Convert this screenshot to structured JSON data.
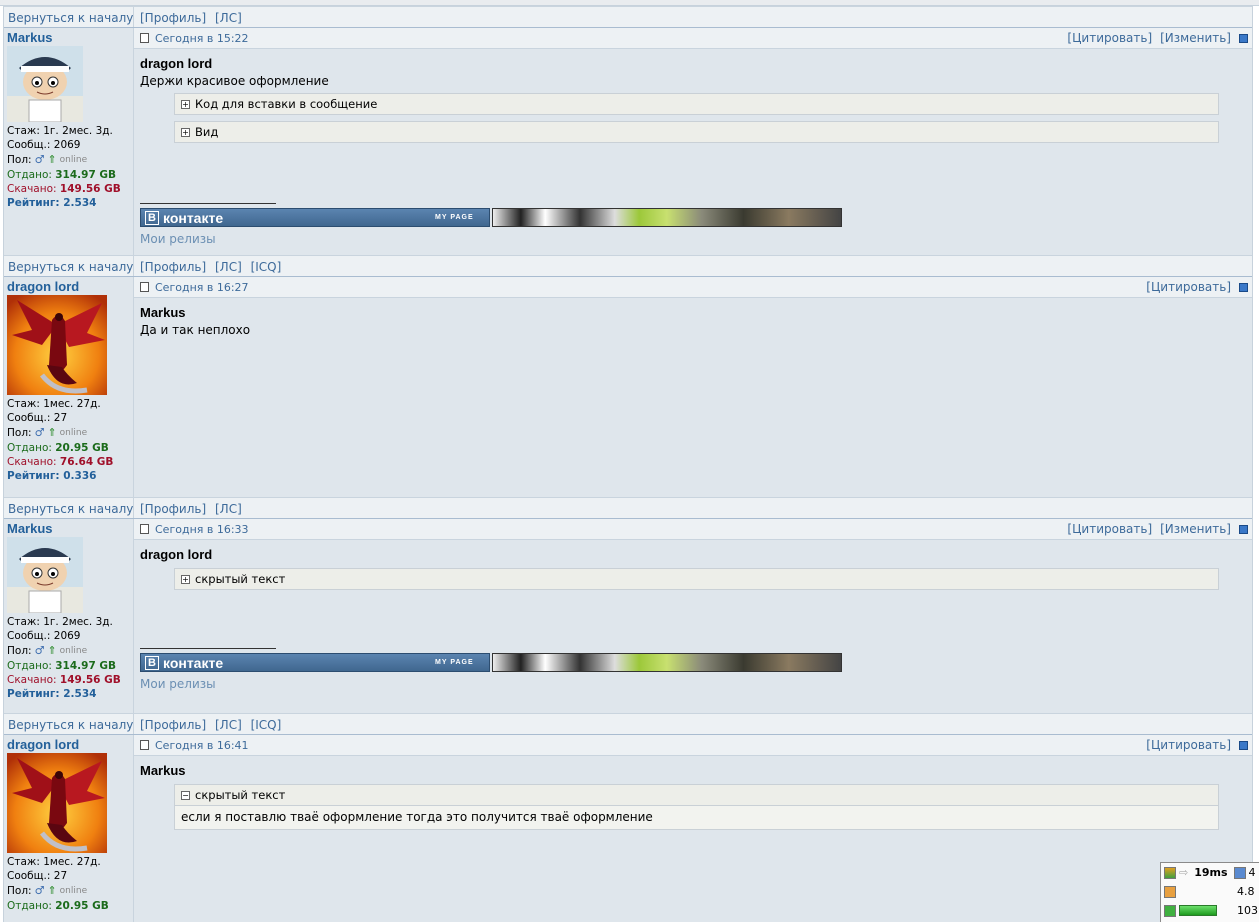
{
  "footer_links": {
    "back": "Вернуться к началу",
    "profile": "[Профиль]",
    "pm": "[ЛС]",
    "icq": "[ICQ]"
  },
  "posts": [
    {
      "author": "Markus",
      "avatar": "stewie-avatar",
      "stazh": "Стаж: 1г. 2мес. 3д.",
      "soob": "Сообщ.: 2069",
      "pol": "Пол:",
      "online": "online",
      "otdano_label": "Отдано:",
      "otdano": "314.97 GB",
      "skachano_label": "Скачано:",
      "skachano": "149.56 GB",
      "rating_label": "Рейтинг:",
      "rating": "2.534",
      "time": "Сегодня в 15:22",
      "actions": [
        "[Цитировать]",
        "[Изменить]"
      ],
      "to": "dragon lord",
      "text": "Держи красивое оформление",
      "spoilers": [
        {
          "title": "Код для вставки в сообщение",
          "sign": "+"
        },
        {
          "title": "Вид",
          "sign": "+"
        }
      ],
      "signature": {
        "vk_brand": "контакте",
        "vk_page": "MY PAGE",
        "releases": "Мои релизы"
      },
      "footer_icq": false
    },
    {
      "author": "dragon lord",
      "avatar": "red-dragon-avatar",
      "stazh": "Стаж: 1мес. 27д.",
      "soob": "Сообщ.: 27",
      "pol": "Пол:",
      "online": "online",
      "otdano_label": "Отдано:",
      "otdano": "20.95 GB",
      "skachano_label": "Скачано:",
      "skachano": "76.64 GB",
      "rating_label": "Рейтинг:",
      "rating": "0.336",
      "time": "Сегодня в 16:27",
      "actions": [
        "[Цитировать]"
      ],
      "to": "Markus",
      "text": "Да и так неплохо",
      "footer_icq": true
    },
    {
      "author": "Markus",
      "avatar": "stewie-avatar",
      "stazh": "Стаж: 1г. 2мес. 3д.",
      "soob": "Сообщ.: 2069",
      "pol": "Пол:",
      "online": "online",
      "otdano_label": "Отдано:",
      "otdano": "314.97 GB",
      "skachano_label": "Скачано:",
      "skachano": "149.56 GB",
      "rating_label": "Рейтинг:",
      "rating": "2.534",
      "time": "Сегодня в 16:33",
      "actions": [
        "[Цитировать]",
        "[Изменить]"
      ],
      "to": "dragon lord",
      "spoilers": [
        {
          "title": "скрытый текст",
          "sign": "+"
        }
      ],
      "signature": {
        "vk_brand": "контакте",
        "vk_page": "MY PAGE",
        "releases": "Мои релизы"
      },
      "footer_icq": false
    },
    {
      "author": "dragon lord",
      "avatar": "red-dragon-avatar",
      "stazh": "Стаж: 1мес. 27д.",
      "soob": "Сообщ.: 27",
      "pol": "Пол:",
      "online": "online",
      "otdano_label": "Отдано:",
      "otdano": "20.95 GB",
      "time": "Сегодня в 16:41",
      "actions": [
        "[Цитировать]"
      ],
      "to": "Markus",
      "spoilers": [
        {
          "title": "скрытый текст",
          "sign": "−",
          "open": true,
          "content": "если я поставлю тваё оформление тогда это получится тваё оформление"
        }
      ],
      "footer_icq": true
    }
  ],
  "tray": {
    "ping": "19ms",
    "v1": "4",
    "v2": "4.8",
    "v3": "103"
  },
  "colors": {
    "link": "#3d6a9a",
    "nick": "#23609a",
    "upload": "#1b6b1b",
    "download": "#a0102a",
    "post_bg": "#dfe6ec"
  }
}
